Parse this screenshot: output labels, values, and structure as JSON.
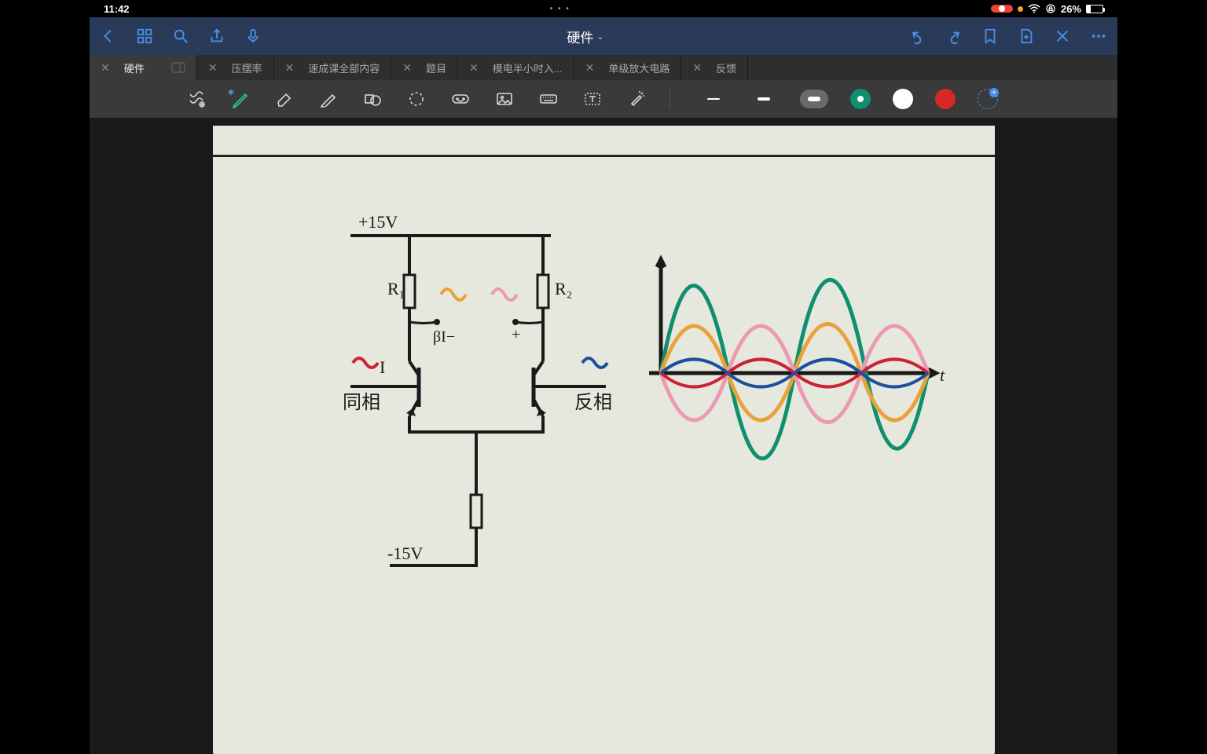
{
  "status": {
    "time": "11:42",
    "battery_pct": "26%",
    "dots": "• • •"
  },
  "nav": {
    "title": "硬件"
  },
  "tabs": [
    {
      "label": "硬件",
      "active": true,
      "split": true
    },
    {
      "label": "压摆率"
    },
    {
      "label": "速成课全部内容"
    },
    {
      "label": "题目"
    },
    {
      "label": "模电半小时入..."
    },
    {
      "label": "单级放大电路"
    },
    {
      "label": "反馈"
    }
  ],
  "colors": {
    "selected": "#0f8f6f",
    "white": "#ffffff",
    "red": "#d62828"
  },
  "note": {
    "v_plus": "+15V",
    "v_minus": "-15V",
    "r1": "R₁",
    "r2": "R₂",
    "beta": "βI−",
    "plus": "+",
    "in_label": "I",
    "left_phase": "同相",
    "right_phase": "反相",
    "axis": "t"
  }
}
